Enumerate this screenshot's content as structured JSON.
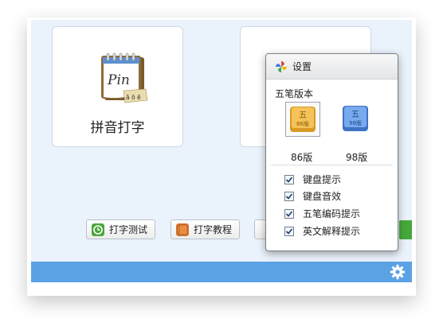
{
  "main": {
    "pinyin_card": {
      "label": "拼音打字",
      "icon_text": "Pin",
      "icon_sub": "ā ō ē"
    },
    "wubi_card": {
      "label": ""
    },
    "buttons": {
      "typing_test": "打字测试",
      "typing_tutorial": "打字教程"
    }
  },
  "settings_popup": {
    "title": "设置",
    "section_title": "五笔版本",
    "versions": [
      {
        "label": "86版",
        "key_char": "五",
        "key_sub": "86版",
        "selected": true
      },
      {
        "label": "98版",
        "key_char": "五",
        "key_sub": "98版",
        "selected": false
      }
    ],
    "options": [
      {
        "label": "键盘提示",
        "checked": true
      },
      {
        "label": "键盘音效",
        "checked": true
      },
      {
        "label": "五笔编码提示",
        "checked": true
      },
      {
        "label": "英文解释提示",
        "checked": true
      }
    ]
  },
  "colors": {
    "bottom_bar": "#5aa2e4",
    "accent_green": "#46a83b",
    "key_86": "#f0b23a",
    "key_98": "#5b93dc"
  },
  "icons": {
    "settings": "gear-icon",
    "popup_logo": "pinwheel-icon",
    "typing_test": "clock-icon",
    "typing_tutorial": "book-icon"
  }
}
